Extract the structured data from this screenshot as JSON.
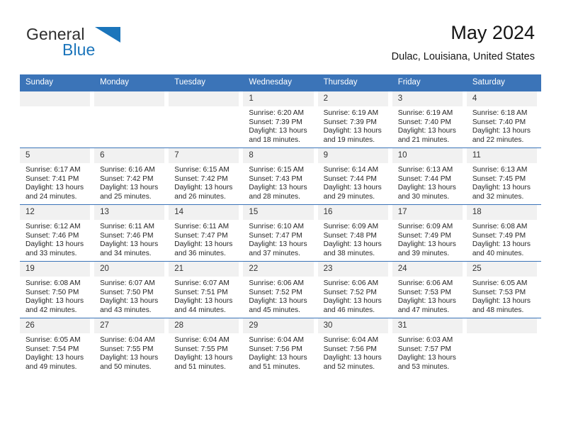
{
  "brand": {
    "name_top": "General",
    "name_bottom": "Blue",
    "accent_color": "#1b75bb",
    "triangle_icon": "logo-triangle-icon"
  },
  "header": {
    "title": "May 2024",
    "location": "Dulac, Louisiana, United States",
    "header_bg_color": "#3b74b8",
    "daynum_bg_color": "#f1f1f1"
  },
  "weekday_headers": [
    "Sunday",
    "Monday",
    "Tuesday",
    "Wednesday",
    "Thursday",
    "Friday",
    "Saturday"
  ],
  "weeks": [
    [
      {
        "day": "",
        "lines": []
      },
      {
        "day": "",
        "lines": []
      },
      {
        "day": "",
        "lines": []
      },
      {
        "day": "1",
        "lines": [
          "Sunrise: 6:20 AM",
          "Sunset: 7:39 PM",
          "Daylight: 13 hours",
          "and 18 minutes."
        ]
      },
      {
        "day": "2",
        "lines": [
          "Sunrise: 6:19 AM",
          "Sunset: 7:39 PM",
          "Daylight: 13 hours",
          "and 19 minutes."
        ]
      },
      {
        "day": "3",
        "lines": [
          "Sunrise: 6:19 AM",
          "Sunset: 7:40 PM",
          "Daylight: 13 hours",
          "and 21 minutes."
        ]
      },
      {
        "day": "4",
        "lines": [
          "Sunrise: 6:18 AM",
          "Sunset: 7:40 PM",
          "Daylight: 13 hours",
          "and 22 minutes."
        ]
      }
    ],
    [
      {
        "day": "5",
        "lines": [
          "Sunrise: 6:17 AM",
          "Sunset: 7:41 PM",
          "Daylight: 13 hours",
          "and 24 minutes."
        ]
      },
      {
        "day": "6",
        "lines": [
          "Sunrise: 6:16 AM",
          "Sunset: 7:42 PM",
          "Daylight: 13 hours",
          "and 25 minutes."
        ]
      },
      {
        "day": "7",
        "lines": [
          "Sunrise: 6:15 AM",
          "Sunset: 7:42 PM",
          "Daylight: 13 hours",
          "and 26 minutes."
        ]
      },
      {
        "day": "8",
        "lines": [
          "Sunrise: 6:15 AM",
          "Sunset: 7:43 PM",
          "Daylight: 13 hours",
          "and 28 minutes."
        ]
      },
      {
        "day": "9",
        "lines": [
          "Sunrise: 6:14 AM",
          "Sunset: 7:44 PM",
          "Daylight: 13 hours",
          "and 29 minutes."
        ]
      },
      {
        "day": "10",
        "lines": [
          "Sunrise: 6:13 AM",
          "Sunset: 7:44 PM",
          "Daylight: 13 hours",
          "and 30 minutes."
        ]
      },
      {
        "day": "11",
        "lines": [
          "Sunrise: 6:13 AM",
          "Sunset: 7:45 PM",
          "Daylight: 13 hours",
          "and 32 minutes."
        ]
      }
    ],
    [
      {
        "day": "12",
        "lines": [
          "Sunrise: 6:12 AM",
          "Sunset: 7:46 PM",
          "Daylight: 13 hours",
          "and 33 minutes."
        ]
      },
      {
        "day": "13",
        "lines": [
          "Sunrise: 6:11 AM",
          "Sunset: 7:46 PM",
          "Daylight: 13 hours",
          "and 34 minutes."
        ]
      },
      {
        "day": "14",
        "lines": [
          "Sunrise: 6:11 AM",
          "Sunset: 7:47 PM",
          "Daylight: 13 hours",
          "and 36 minutes."
        ]
      },
      {
        "day": "15",
        "lines": [
          "Sunrise: 6:10 AM",
          "Sunset: 7:47 PM",
          "Daylight: 13 hours",
          "and 37 minutes."
        ]
      },
      {
        "day": "16",
        "lines": [
          "Sunrise: 6:09 AM",
          "Sunset: 7:48 PM",
          "Daylight: 13 hours",
          "and 38 minutes."
        ]
      },
      {
        "day": "17",
        "lines": [
          "Sunrise: 6:09 AM",
          "Sunset: 7:49 PM",
          "Daylight: 13 hours",
          "and 39 minutes."
        ]
      },
      {
        "day": "18",
        "lines": [
          "Sunrise: 6:08 AM",
          "Sunset: 7:49 PM",
          "Daylight: 13 hours",
          "and 40 minutes."
        ]
      }
    ],
    [
      {
        "day": "19",
        "lines": [
          "Sunrise: 6:08 AM",
          "Sunset: 7:50 PM",
          "Daylight: 13 hours",
          "and 42 minutes."
        ]
      },
      {
        "day": "20",
        "lines": [
          "Sunrise: 6:07 AM",
          "Sunset: 7:50 PM",
          "Daylight: 13 hours",
          "and 43 minutes."
        ]
      },
      {
        "day": "21",
        "lines": [
          "Sunrise: 6:07 AM",
          "Sunset: 7:51 PM",
          "Daylight: 13 hours",
          "and 44 minutes."
        ]
      },
      {
        "day": "22",
        "lines": [
          "Sunrise: 6:06 AM",
          "Sunset: 7:52 PM",
          "Daylight: 13 hours",
          "and 45 minutes."
        ]
      },
      {
        "day": "23",
        "lines": [
          "Sunrise: 6:06 AM",
          "Sunset: 7:52 PM",
          "Daylight: 13 hours",
          "and 46 minutes."
        ]
      },
      {
        "day": "24",
        "lines": [
          "Sunrise: 6:06 AM",
          "Sunset: 7:53 PM",
          "Daylight: 13 hours",
          "and 47 minutes."
        ]
      },
      {
        "day": "25",
        "lines": [
          "Sunrise: 6:05 AM",
          "Sunset: 7:53 PM",
          "Daylight: 13 hours",
          "and 48 minutes."
        ]
      }
    ],
    [
      {
        "day": "26",
        "lines": [
          "Sunrise: 6:05 AM",
          "Sunset: 7:54 PM",
          "Daylight: 13 hours",
          "and 49 minutes."
        ]
      },
      {
        "day": "27",
        "lines": [
          "Sunrise: 6:04 AM",
          "Sunset: 7:55 PM",
          "Daylight: 13 hours",
          "and 50 minutes."
        ]
      },
      {
        "day": "28",
        "lines": [
          "Sunrise: 6:04 AM",
          "Sunset: 7:55 PM",
          "Daylight: 13 hours",
          "and 51 minutes."
        ]
      },
      {
        "day": "29",
        "lines": [
          "Sunrise: 6:04 AM",
          "Sunset: 7:56 PM",
          "Daylight: 13 hours",
          "and 51 minutes."
        ]
      },
      {
        "day": "30",
        "lines": [
          "Sunrise: 6:04 AM",
          "Sunset: 7:56 PM",
          "Daylight: 13 hours",
          "and 52 minutes."
        ]
      },
      {
        "day": "31",
        "lines": [
          "Sunrise: 6:03 AM",
          "Sunset: 7:57 PM",
          "Daylight: 13 hours",
          "and 53 minutes."
        ]
      },
      {
        "day": "",
        "lines": []
      }
    ]
  ]
}
